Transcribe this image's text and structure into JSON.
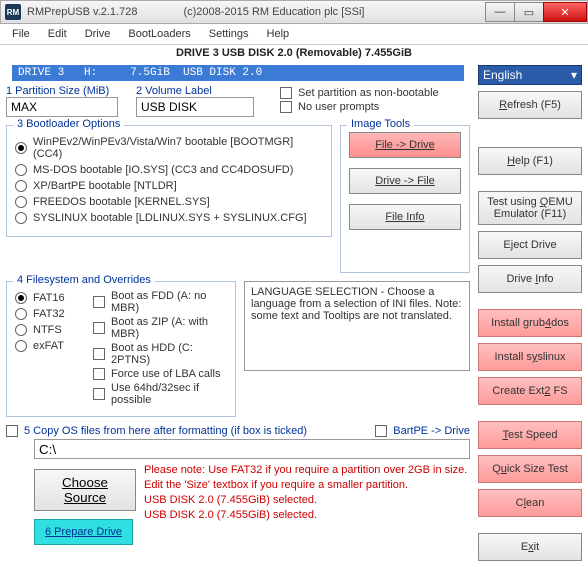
{
  "titlebar": {
    "app_icon_text": "RM",
    "title": "RMPrepUSB v.2.1.728",
    "copyright": "(c)2008-2015 RM Education plc [SSi]",
    "min": "—",
    "max": "▭",
    "close": "✕"
  },
  "menu": {
    "file": "File",
    "edit": "Edit",
    "drive": "Drive",
    "bootloaders": "BootLoaders",
    "settings": "Settings",
    "help": "Help"
  },
  "drive": {
    "header": "DRIVE 3 USB DISK 2.0  (Removable) 7.455GiB",
    "mono": "DRIVE 3   H:     7.5GiB  USB DISK 2.0"
  },
  "side": {
    "language": "English",
    "refresh": "Refresh (F5)",
    "help": "Help (F1)",
    "test_qemu": "Test using QEMU Emulator (F11)",
    "eject": "Eject Drive",
    "drive_info": "Drive Info",
    "grub4dos": "Install grub4dos",
    "syslinux": "Install syslinux",
    "ext2": "Create Ext2 FS",
    "testspeed": "Test Speed",
    "quicksize": "Quick Size Test",
    "clean": "Clean",
    "exit": "Exit"
  },
  "part": {
    "label1": "1 Partition Size (MiB)",
    "value1": "MAX",
    "label2": "2 Volume Label",
    "value2": "USB DISK",
    "nonboot": "Set partition as non-bootable",
    "noprompts": "No user prompts"
  },
  "boot": {
    "legend": "3 Bootloader Options",
    "o1": "WinPEv2/WinPEv3/Vista/Win7 bootable [BOOTMGR] (CC4)",
    "o2": "MS-DOS bootable [IO.SYS]    (CC3 and CC4DOSUFD)",
    "o3": "XP/BartPE bootable [NTLDR]",
    "o4": "FREEDOS bootable [KERNEL.SYS]",
    "o5": "SYSLINUX bootable [LDLINUX.SYS + SYSLINUX.CFG]"
  },
  "imgtools": {
    "legend": "Image Tools",
    "b1": "File -> Drive",
    "b2": "Drive -> File",
    "b3": "File Info"
  },
  "fs": {
    "legend": "4 Filesystem and Overrides",
    "fat16": "FAT16",
    "fat32": "FAT32",
    "ntfs": "NTFS",
    "exfat": "exFAT",
    "fdd": "Boot as FDD (A: no MBR)",
    "zip": "Boot as ZIP (A: with MBR)",
    "hdd": "Boot as HDD (C: 2PTNS)",
    "lba": "Force use of LBA calls",
    "hd64": "Use 64hd/32sec if possible"
  },
  "langselect": "LANGUAGE SELECTION - Choose a language from a selection of INI files. Note: some text and Tooltips are not translated.",
  "below": {
    "copyos": "5 Copy OS files from here after formatting (if box is ticked)",
    "bartpe": "BartPE -> Drive"
  },
  "path": "C:\\",
  "choose": "Choose Source",
  "note": {
    "l1": "Please note: Use FAT32 if you require a partition over 2GB in size.",
    "l2": "Edit the 'Size' textbox if you require a smaller partition.",
    "l3": "USB DISK 2.0 (7.455GiB) selected.",
    "l4": "USB DISK 2.0 (7.455GiB) selected."
  },
  "prepare": "6 Prepare Drive"
}
